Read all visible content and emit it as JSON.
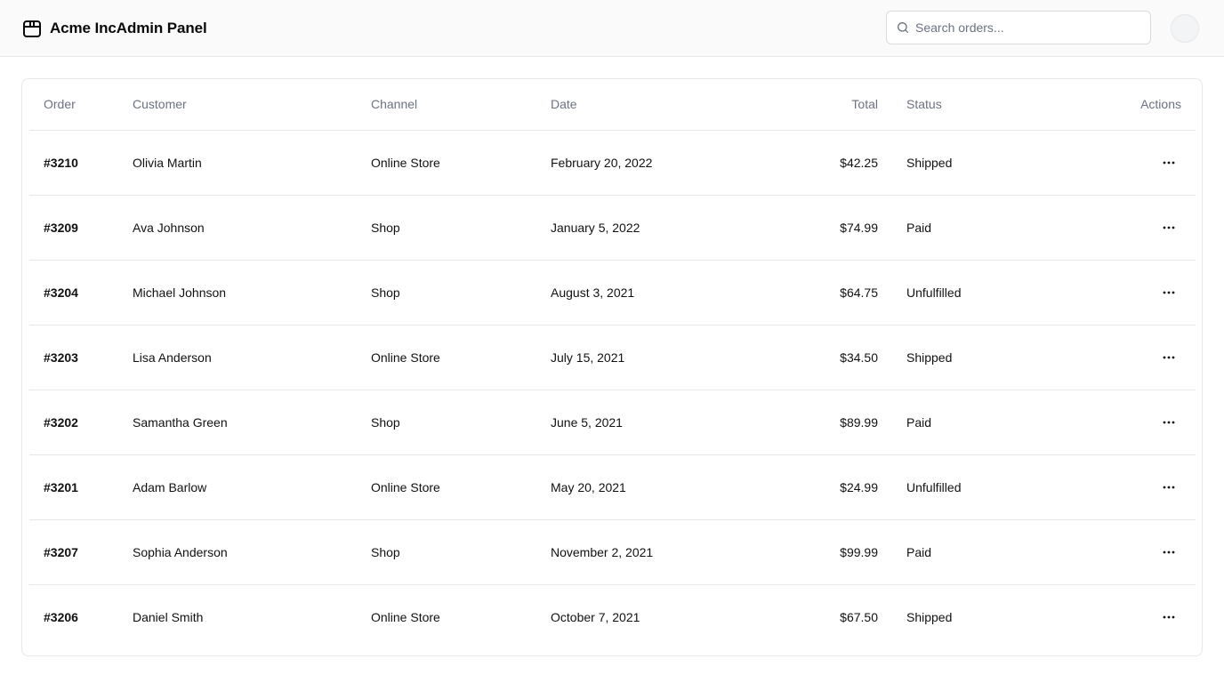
{
  "header": {
    "brand": "Acme IncAdmin Panel",
    "search_placeholder": "Search orders..."
  },
  "table": {
    "columns": {
      "order": "Order",
      "customer": "Customer",
      "channel": "Channel",
      "date": "Date",
      "total": "Total",
      "status": "Status",
      "actions": "Actions"
    },
    "rows": [
      {
        "order": "#3210",
        "customer": "Olivia Martin",
        "channel": "Online Store",
        "date": "February 20, 2022",
        "total": "$42.25",
        "status": "Shipped"
      },
      {
        "order": "#3209",
        "customer": "Ava Johnson",
        "channel": "Shop",
        "date": "January 5, 2022",
        "total": "$74.99",
        "status": "Paid"
      },
      {
        "order": "#3204",
        "customer": "Michael Johnson",
        "channel": "Shop",
        "date": "August 3, 2021",
        "total": "$64.75",
        "status": "Unfulfilled"
      },
      {
        "order": "#3203",
        "customer": "Lisa Anderson",
        "channel": "Online Store",
        "date": "July 15, 2021",
        "total": "$34.50",
        "status": "Shipped"
      },
      {
        "order": "#3202",
        "customer": "Samantha Green",
        "channel": "Shop",
        "date": "June 5, 2021",
        "total": "$89.99",
        "status": "Paid"
      },
      {
        "order": "#3201",
        "customer": "Adam Barlow",
        "channel": "Online Store",
        "date": "May 20, 2021",
        "total": "$24.99",
        "status": "Unfulfilled"
      },
      {
        "order": "#3207",
        "customer": "Sophia Anderson",
        "channel": "Shop",
        "date": "November 2, 2021",
        "total": "$99.99",
        "status": "Paid"
      },
      {
        "order": "#3206",
        "customer": "Daniel Smith",
        "channel": "Online Store",
        "date": "October 7, 2021",
        "total": "$67.50",
        "status": "Shipped"
      }
    ]
  },
  "icons": {
    "brand": "package-icon",
    "search": "search-icon",
    "row_action": "more-horizontal-icon"
  },
  "colors": {
    "header_bg": "#f9faf9",
    "border": "#e5e7eb",
    "muted_text": "#6b7280"
  }
}
